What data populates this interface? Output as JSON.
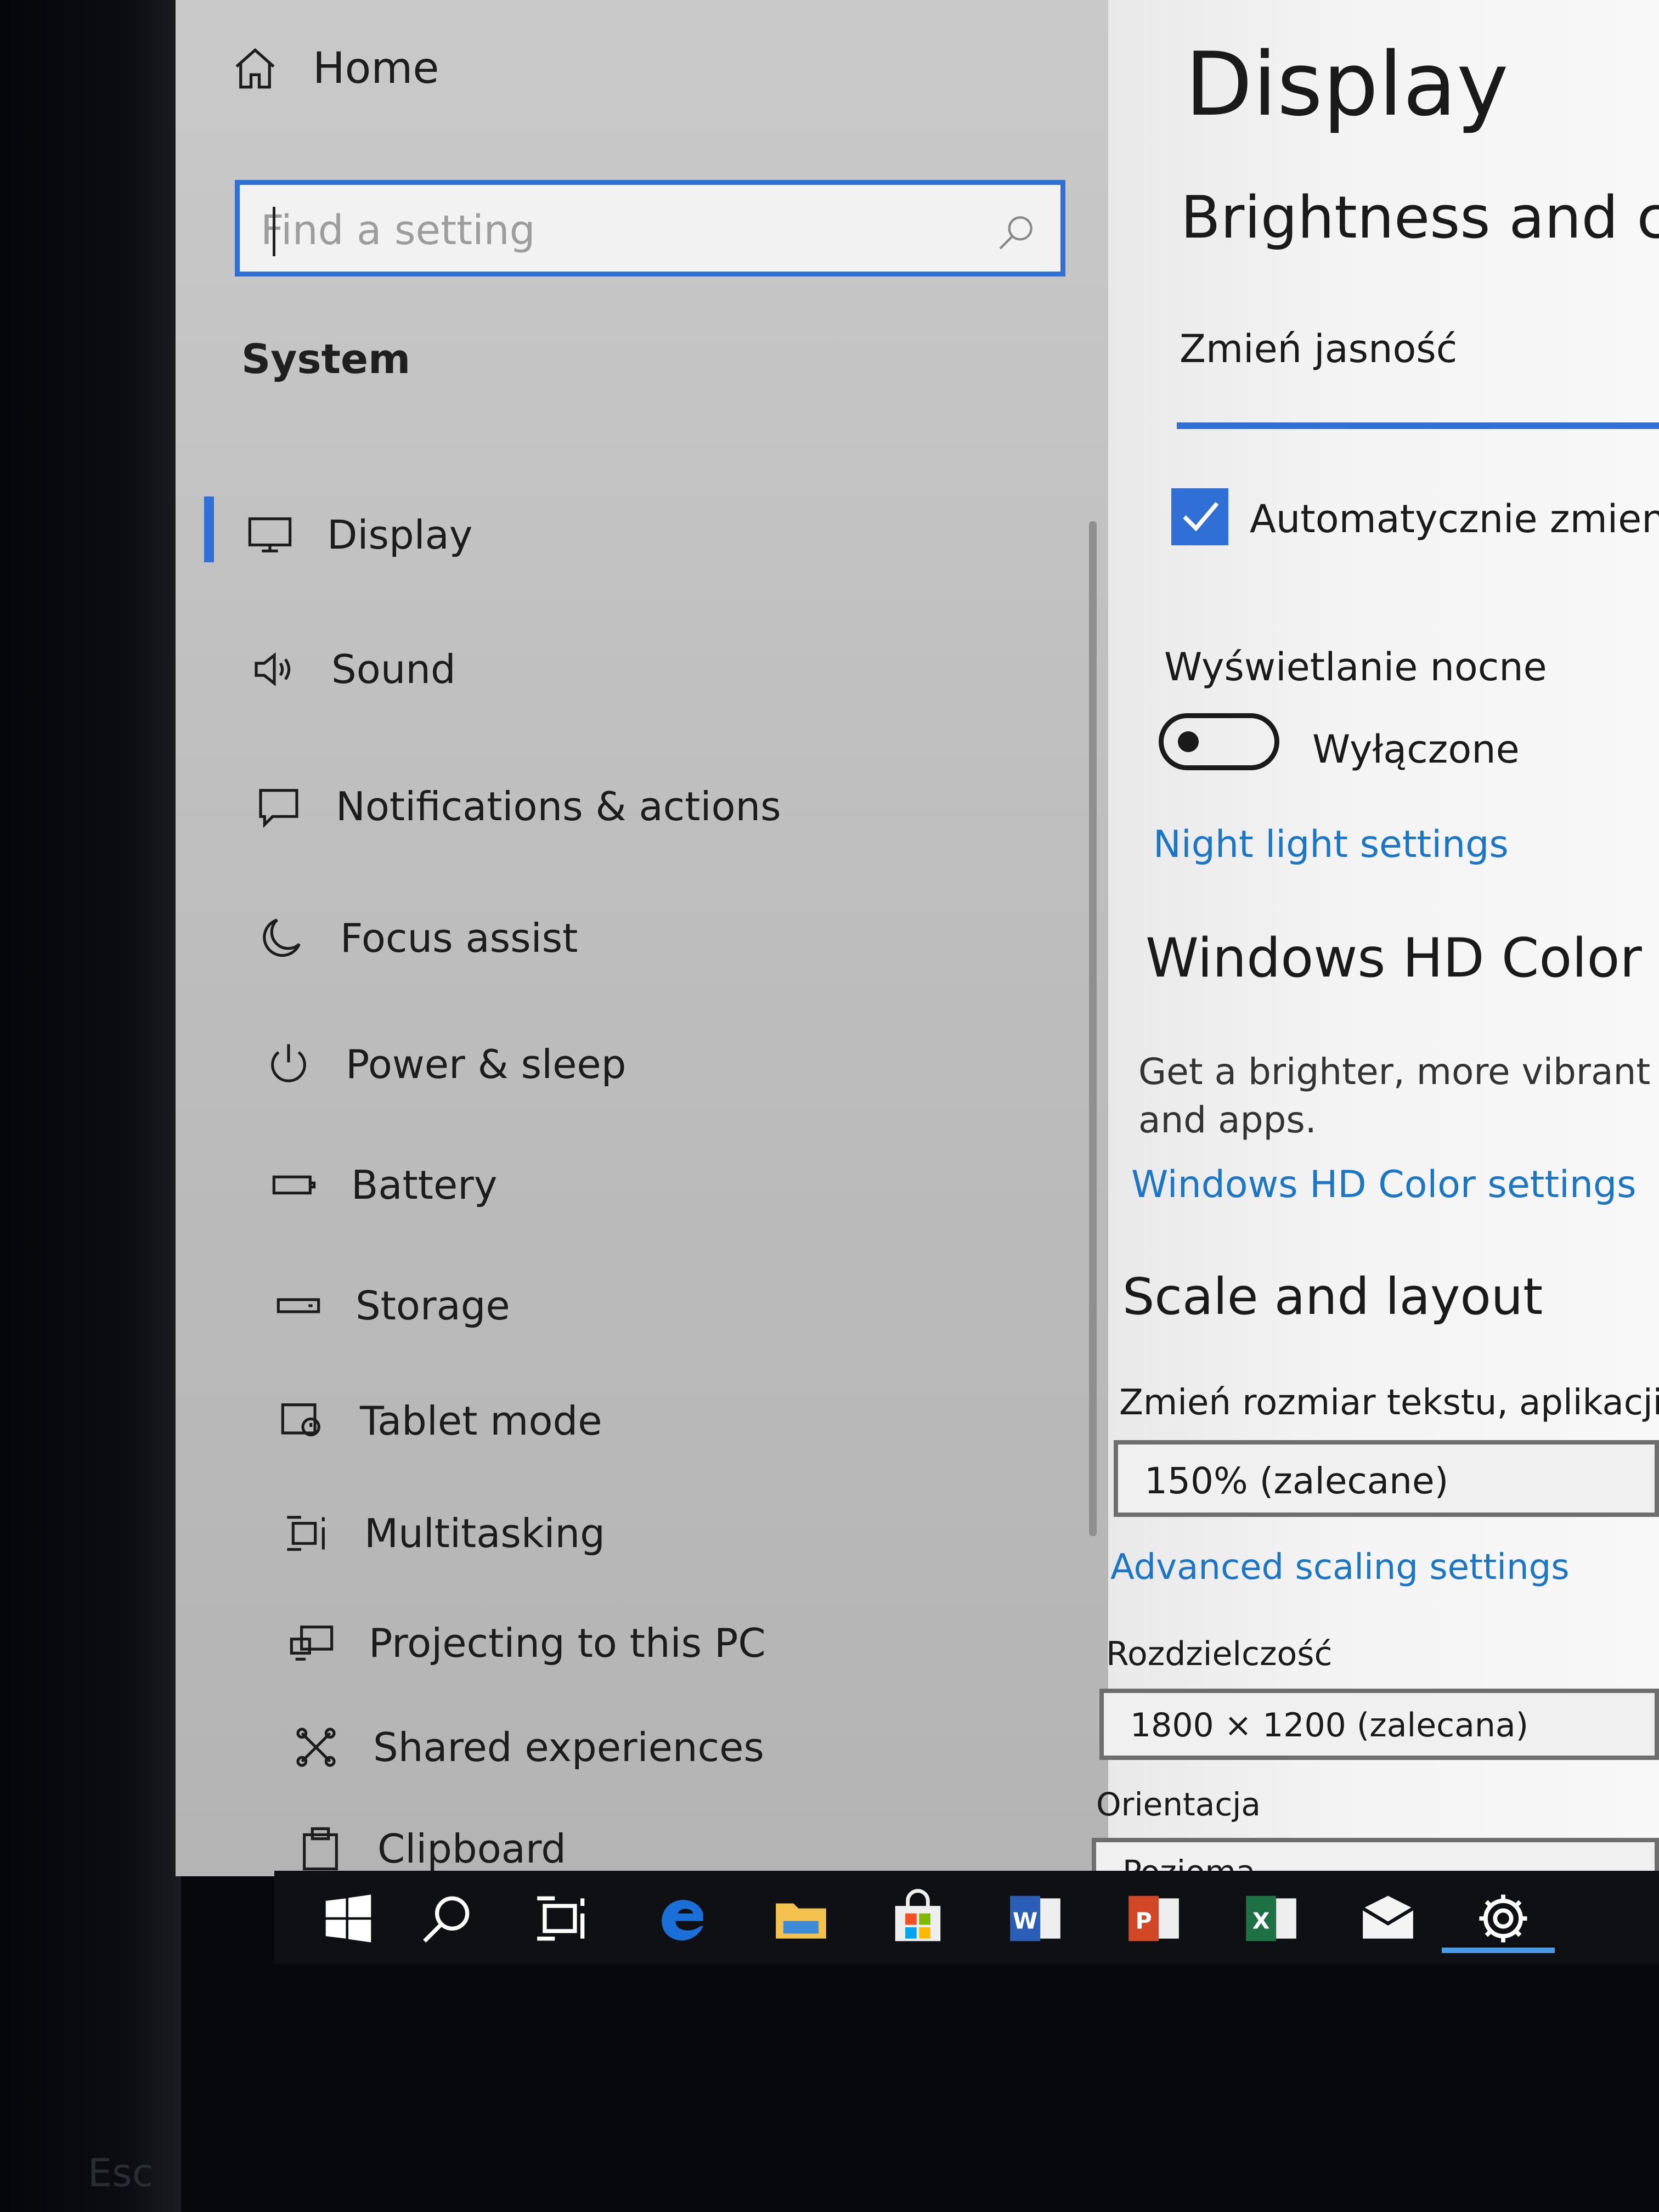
{
  "sidebar": {
    "home_label": "Home",
    "search_placeholder": "Find a setting",
    "section_title": "System",
    "items": [
      {
        "label": "Display",
        "icon": "monitor-icon"
      },
      {
        "label": "Sound",
        "icon": "speaker-icon"
      },
      {
        "label": "Notifications & actions",
        "icon": "notification-icon"
      },
      {
        "label": "Focus assist",
        "icon": "moon-icon"
      },
      {
        "label": "Power & sleep",
        "icon": "power-icon"
      },
      {
        "label": "Battery",
        "icon": "battery-icon"
      },
      {
        "label": "Storage",
        "icon": "storage-icon"
      },
      {
        "label": "Tablet mode",
        "icon": "tablet-mode-icon"
      },
      {
        "label": "Multitasking",
        "icon": "multitasking-icon"
      },
      {
        "label": "Projecting to this PC",
        "icon": "projecting-icon"
      },
      {
        "label": "Shared experiences",
        "icon": "shared-experiences-icon"
      },
      {
        "label": "Clipboard",
        "icon": "clipboard-icon"
      }
    ],
    "selected": "Display"
  },
  "content": {
    "page_title": "Display",
    "brightness_heading": "Brightness and colo",
    "brightness_label": "Zmień jasność",
    "auto_brightness_label": "Automatycznie zmieniaj",
    "auto_brightness_checked": true,
    "night_light_label": "Wyświetlanie nocne",
    "night_light_state": "Wyłączone",
    "night_light_link": "Night light settings",
    "hd_color_heading": "Windows HD Color",
    "hd_color_desc_line1": "Get a brighter, more vibrant pict",
    "hd_color_desc_line2": "and apps.",
    "hd_color_link": "Windows HD Color settings",
    "scale_heading": "Scale and layout",
    "scale_label": "Zmień rozmiar tekstu, aplikacji i inn",
    "scale_value": "150% (zalecane)",
    "advanced_scaling_link": "Advanced scaling settings",
    "resolution_label": "Rozdzielczość",
    "resolution_value": "1800 × 1200 (zalecana)",
    "orientation_label": "Orientacja",
    "orientation_value": "Pozioma"
  },
  "taskbar": {
    "icons": [
      "windows-start-icon",
      "search-icon",
      "task-view-icon",
      "edge-icon",
      "file-explorer-icon",
      "store-icon",
      "word-icon",
      "powerpoint-icon",
      "excel-icon",
      "mail-icon",
      "settings-gear-icon"
    ],
    "active": "settings-gear-icon"
  },
  "keyboard": {
    "esc_label": "Esc"
  },
  "colors": {
    "accent": "#2f6fd6",
    "link": "#1b76c6"
  }
}
